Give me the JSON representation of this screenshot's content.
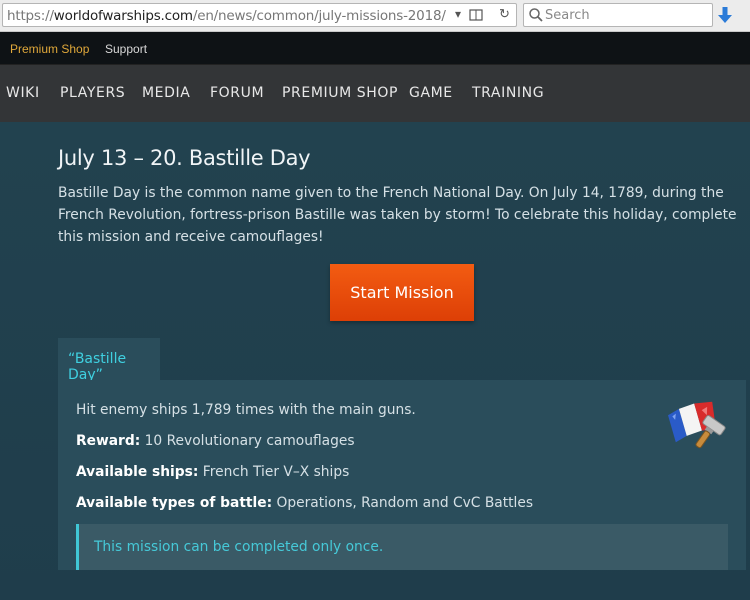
{
  "browser": {
    "url_prefix": "https://",
    "url_host": "worldofwarships.com",
    "url_path": "/en/news/common/july-missions-2018/",
    "search_placeholder": "Search"
  },
  "topbar": {
    "premium_shop": "Premium Shop",
    "support": "Support"
  },
  "nav": {
    "items": [
      "WIKI",
      "PLAYERS",
      "MEDIA",
      "FORUM",
      "PREMIUM SHOP",
      "GAME",
      "TRAINING"
    ]
  },
  "article": {
    "title": "July 13 – 20. Bastille Day",
    "description": "Bastille Day is the common name given to the French National Day. On July 14, 1789, during the French Revolution, fortress-prison Bastille was taken by storm! To celebrate this holiday, complete this mission and receive camouflages!",
    "start_button": "Start Mission"
  },
  "mission": {
    "tab_label": "“Bastille Day”",
    "task": "Hit enemy ships 1,789 times with the main guns.",
    "reward_label": "Reward:",
    "reward_value": "10 Revolutionary camouflages",
    "ships_label": "Available ships:",
    "ships_value": "French Tier V–X ships",
    "battle_label": "Available types of battle:",
    "battle_value": "Operations, Random and CvC Battles",
    "notice": "This mission can be completed only once."
  },
  "colors": {
    "accent_orange": "#e8490b",
    "accent_cyan": "#40c7d6",
    "premium_gold": "#e0a83a"
  }
}
